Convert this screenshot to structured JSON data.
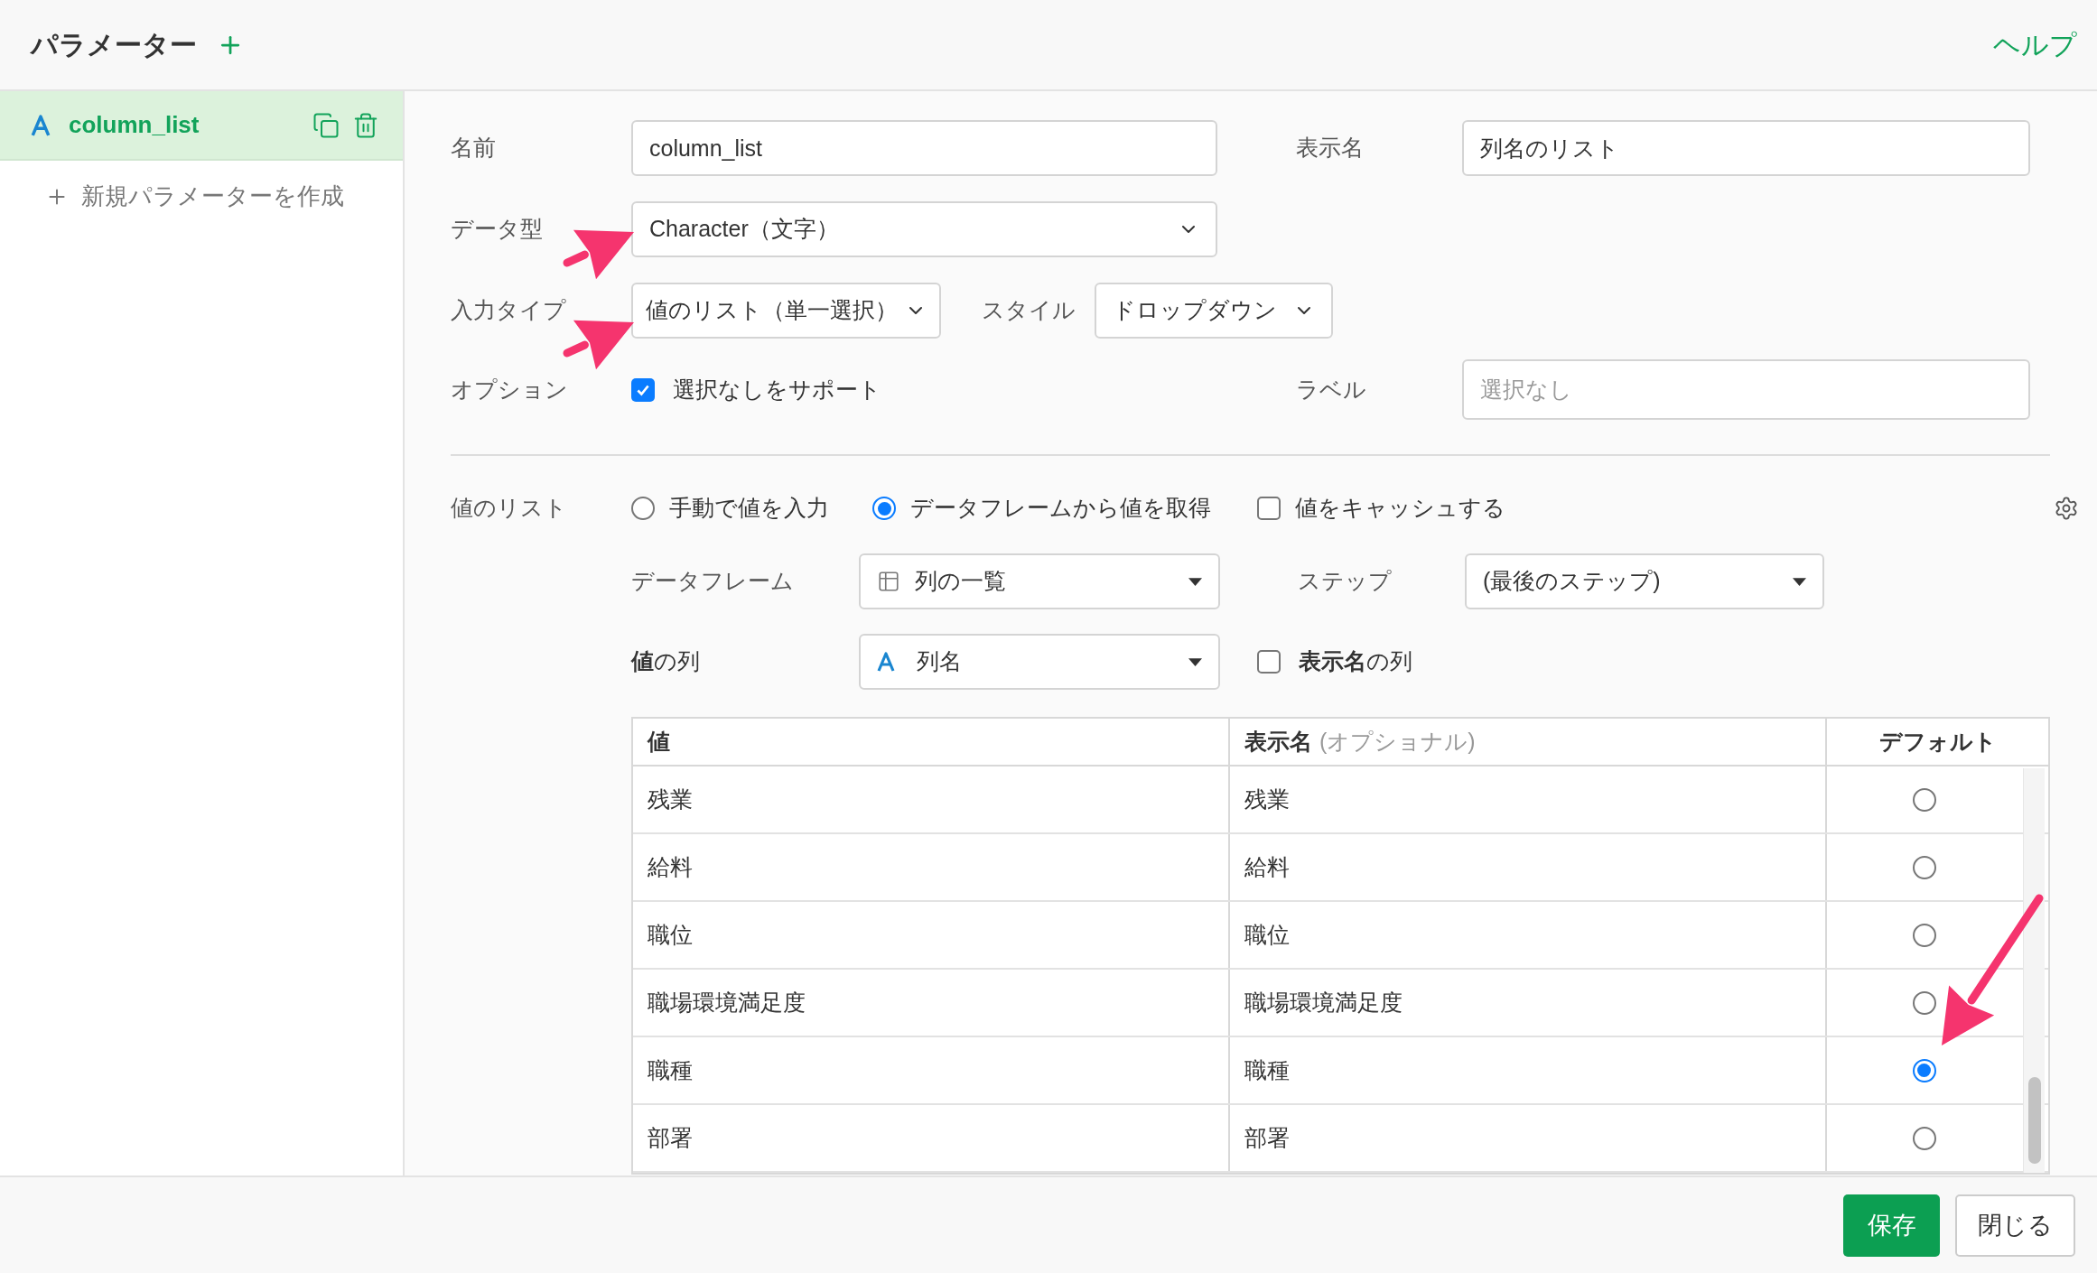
{
  "header": {
    "title": "パラメーター",
    "help_link": "ヘルプ"
  },
  "sidebar": {
    "items": [
      {
        "name": "column_list",
        "selected": true
      }
    ],
    "new_button": "新規パラメーターを作成"
  },
  "form": {
    "name": {
      "label": "名前",
      "value": "column_list"
    },
    "display_name": {
      "label": "表示名",
      "value": "列名のリスト"
    },
    "data_type": {
      "label": "データ型",
      "value": "Character（文字）"
    },
    "input_type": {
      "label": "入力タイプ",
      "value": "値のリスト（単一選択）"
    },
    "style": {
      "label": "スタイル",
      "value": "ドロップダウン"
    },
    "options": {
      "label": "オプション",
      "checkbox": {
        "label": "選択なしをサポート",
        "checked": true
      }
    },
    "label_field": {
      "label": "ラベル",
      "placeholder": "選択なし"
    }
  },
  "value_list": {
    "label": "値のリスト",
    "sources": [
      {
        "label": "手動で値を入力",
        "selected": false
      },
      {
        "label": "データフレームから値を取得",
        "selected": true
      }
    ],
    "cache": {
      "label": "値をキャッシュする",
      "checked": false
    },
    "dataframe": {
      "label": "データフレーム",
      "value": "列の一覧"
    },
    "step": {
      "label": "ステップ",
      "value": "(最後のステップ)"
    },
    "value_column": {
      "label": "**値**の列",
      "value": "列名"
    },
    "display_column": {
      "label": "**表示名**の列",
      "checked": false
    }
  },
  "table": {
    "columns": [
      {
        "label": "値"
      },
      {
        "label": "表示名",
        "note": "(オプショナル)"
      },
      {
        "label": "デフォルト"
      }
    ],
    "rows": [
      {
        "value": "残業",
        "display": "残業",
        "selected": false
      },
      {
        "value": "給料",
        "display": "給料",
        "selected": false
      },
      {
        "value": "職位",
        "display": "職位",
        "selected": false
      },
      {
        "value": "職場環境満足度",
        "display": "職場環境満足度",
        "selected": false
      },
      {
        "value": "職種",
        "display": "職種",
        "selected": true
      },
      {
        "value": "部署",
        "display": "部署",
        "selected": false
      }
    ]
  },
  "footer": {
    "buttons": [
      {
        "label": "保存",
        "kind": "primary"
      },
      {
        "label": "閉じる",
        "kind": "secondary"
      }
    ]
  }
}
